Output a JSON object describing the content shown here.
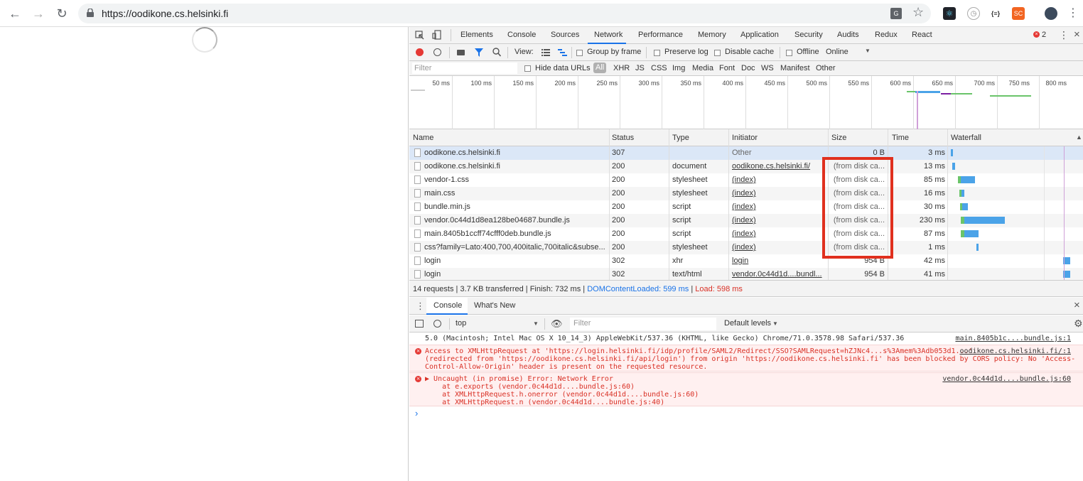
{
  "browser": {
    "url": "https://oodikone.cs.helsinki.fi",
    "extensions": [
      "translate-icon",
      "star-icon",
      "react-icon",
      "timer-icon",
      "json-icon",
      "sc-icon",
      "avatar",
      "menu-icon"
    ],
    "ext_json_label": "{≡}",
    "ext_sc_label": "SC"
  },
  "devtools": {
    "tabs": [
      "Elements",
      "Console",
      "Sources",
      "Network",
      "Performance",
      "Memory",
      "Application",
      "Security",
      "Audits",
      "Redux",
      "React"
    ],
    "active_tab": "Network",
    "error_count": "2",
    "network_toolbar": {
      "view_label": "View:",
      "group_by_frame": "Group by frame",
      "preserve_log": "Preserve log",
      "disable_cache": "Disable cache",
      "offline": "Offline",
      "throttle": "Online"
    },
    "filter_bar": {
      "placeholder": "Filter",
      "hide_data_urls": "Hide data URLs",
      "types": [
        "All",
        "XHR",
        "JS",
        "CSS",
        "Img",
        "Media",
        "Font",
        "Doc",
        "WS",
        "Manifest",
        "Other"
      ]
    },
    "overview_ticks": [
      "50 ms",
      "100 ms",
      "150 ms",
      "200 ms",
      "250 ms",
      "300 ms",
      "350 ms",
      "400 ms",
      "450 ms",
      "500 ms",
      "550 ms",
      "600 ms",
      "650 ms",
      "700 ms",
      "750 ms",
      "800 ms"
    ],
    "columns": [
      "Name",
      "Status",
      "Type",
      "Initiator",
      "Size",
      "Time",
      "Waterfall"
    ],
    "requests": [
      {
        "name": "oodikone.cs.helsinki.fi",
        "status": "307",
        "type": "",
        "initiator": "Other",
        "size": "0 B",
        "time": "3 ms",
        "initiator_link": false
      },
      {
        "name": "oodikone.cs.helsinki.fi",
        "status": "200",
        "type": "document",
        "initiator": "oodikone.cs.helsinki.fi/",
        "size": "(from disk ca...",
        "time": "13 ms",
        "initiator_link": true
      },
      {
        "name": "vendor-1.css",
        "status": "200",
        "type": "stylesheet",
        "initiator": "(index)",
        "size": "(from disk ca...",
        "time": "85 ms",
        "initiator_link": true
      },
      {
        "name": "main.css",
        "status": "200",
        "type": "stylesheet",
        "initiator": "(index)",
        "size": "(from disk ca...",
        "time": "16 ms",
        "initiator_link": true
      },
      {
        "name": "bundle.min.js",
        "status": "200",
        "type": "script",
        "initiator": "(index)",
        "size": "(from disk ca...",
        "time": "30 ms",
        "initiator_link": true
      },
      {
        "name": "vendor.0c44d1d8ea128be04687.bundle.js",
        "status": "200",
        "type": "script",
        "initiator": "(index)",
        "size": "(from disk ca...",
        "time": "230 ms",
        "initiator_link": true
      },
      {
        "name": "main.8405b1ccff74cfff0deb.bundle.js",
        "status": "200",
        "type": "script",
        "initiator": "(index)",
        "size": "(from disk ca...",
        "time": "87 ms",
        "initiator_link": true
      },
      {
        "name": "css?family=Lato:400,700,400italic,700italic&subse...",
        "status": "200",
        "type": "stylesheet",
        "initiator": "(index)",
        "size": "(from disk ca...",
        "time": "1 ms",
        "initiator_link": true
      },
      {
        "name": "login",
        "status": "302",
        "type": "xhr",
        "initiator": "login",
        "size": "954 B",
        "time": "42 ms",
        "initiator_link": true
      },
      {
        "name": "login",
        "status": "302",
        "type": "text/html",
        "initiator": "vendor.0c44d1d....bundl...",
        "size": "954 B",
        "time": "41 ms",
        "initiator_link": true
      }
    ],
    "summary": {
      "main": "14 requests | 3.7 KB transferred | Finish: 732 ms | ",
      "dcl": "DOMContentLoaded: 599 ms",
      "sep": " | ",
      "load": "Load: 598 ms"
    },
    "drawer": {
      "tabs": [
        "Console",
        "What's New"
      ],
      "context": "top",
      "filter_placeholder": "Filter",
      "levels": "Default levels"
    },
    "console": {
      "ua_line": "5.0 (Macintosh; Intel Mac OS X 10_14_3) AppleWebKit/537.36 (KHTML, like Gecko) Chrome/71.0.3578.98 Safari/537.36",
      "ua_src": "main.8405b1c....bundle.js:1",
      "err1_line1": "Access to XMLHttpRequest at 'https://login.helsinki.fi/idp/profile/SAML2/Redirect/SSO?SAMLRequest=hZJNc4...s%3Amem%3Adb053d1...'",
      "err1_line2": "(redirected from 'https://oodikone.cs.helsinki.fi/api/login') from origin 'https://oodikone.cs.helsinki.fi' has been blocked by CORS policy: No 'Access-",
      "err1_line3": "Control-Allow-Origin' header is present on the requested resource.",
      "err1_src": "oodikone.cs.helsinki.fi/:1",
      "err2_line1": "▶ Uncaught (in promise) Error: Network Error",
      "err2_line2": "    at e.exports (vendor.0c44d1d....bundle.js:60)",
      "err2_line3": "    at XMLHttpRequest.h.onerror (vendor.0c44d1d....bundle.js:60)",
      "err2_line4": "    at XMLHttpRequest.n (vendor.0c44d1d....bundle.js:40)",
      "err2_src": "vendor.0c44d1d....bundle.js:60",
      "prompt": "›"
    }
  }
}
